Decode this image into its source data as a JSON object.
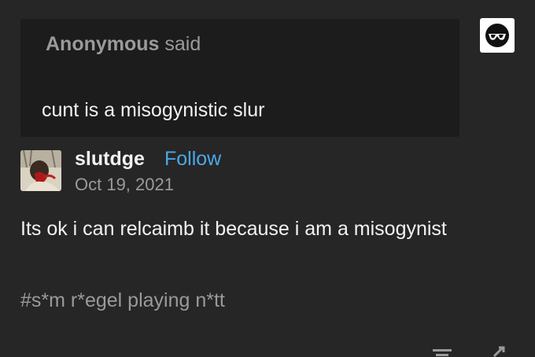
{
  "ask": {
    "asker": "Anonymous",
    "verb": "said",
    "question": "cunt is a misogynistic slur",
    "avatar_icon": "anonymous-sunglasses-icon"
  },
  "post": {
    "username": "slutdge",
    "follow_label": "Follow",
    "date": "Oct 19, 2021",
    "body": "Its ok i can relcaimb it because i am a misogynist",
    "tags": "#s*m r*egel playing n*tt"
  },
  "colors": {
    "background": "#262626",
    "ask_background": "#1c1c1c",
    "link": "#4aa8e8",
    "muted": "#9a9a9a",
    "text": "#f2f2f2"
  },
  "footer": {
    "icons": [
      "notes-icon",
      "reblog-icon"
    ]
  }
}
